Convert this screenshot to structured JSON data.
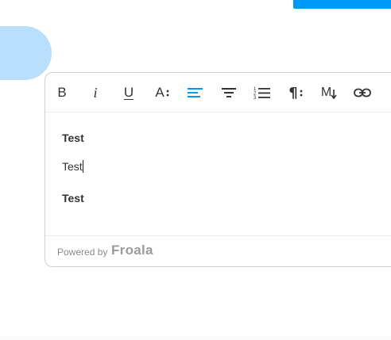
{
  "toolbar": {
    "buttons": [
      {
        "name": "bold",
        "label": "B"
      },
      {
        "name": "italic",
        "label": "i"
      },
      {
        "name": "underline",
        "label": "U"
      },
      {
        "name": "font-size",
        "label": "A"
      },
      {
        "name": "align-left"
      },
      {
        "name": "align-center"
      },
      {
        "name": "ordered-list"
      },
      {
        "name": "paragraph-format",
        "label": "¶"
      },
      {
        "name": "markdown",
        "label": "M"
      },
      {
        "name": "insert-link"
      },
      {
        "name": "more-info"
      }
    ],
    "active_color": "#0098f7"
  },
  "editor": {
    "paragraphs": [
      {
        "text": "Test",
        "bold": true
      },
      {
        "text": "Test",
        "bold": false
      },
      {
        "text": "Test",
        "bold": true
      }
    ]
  },
  "footer": {
    "powered_by": "Powered by",
    "brand": "Froala"
  },
  "colors": {
    "primary": "#0098f7",
    "blob": "#b8dffd",
    "border": "#d0d0d0"
  }
}
